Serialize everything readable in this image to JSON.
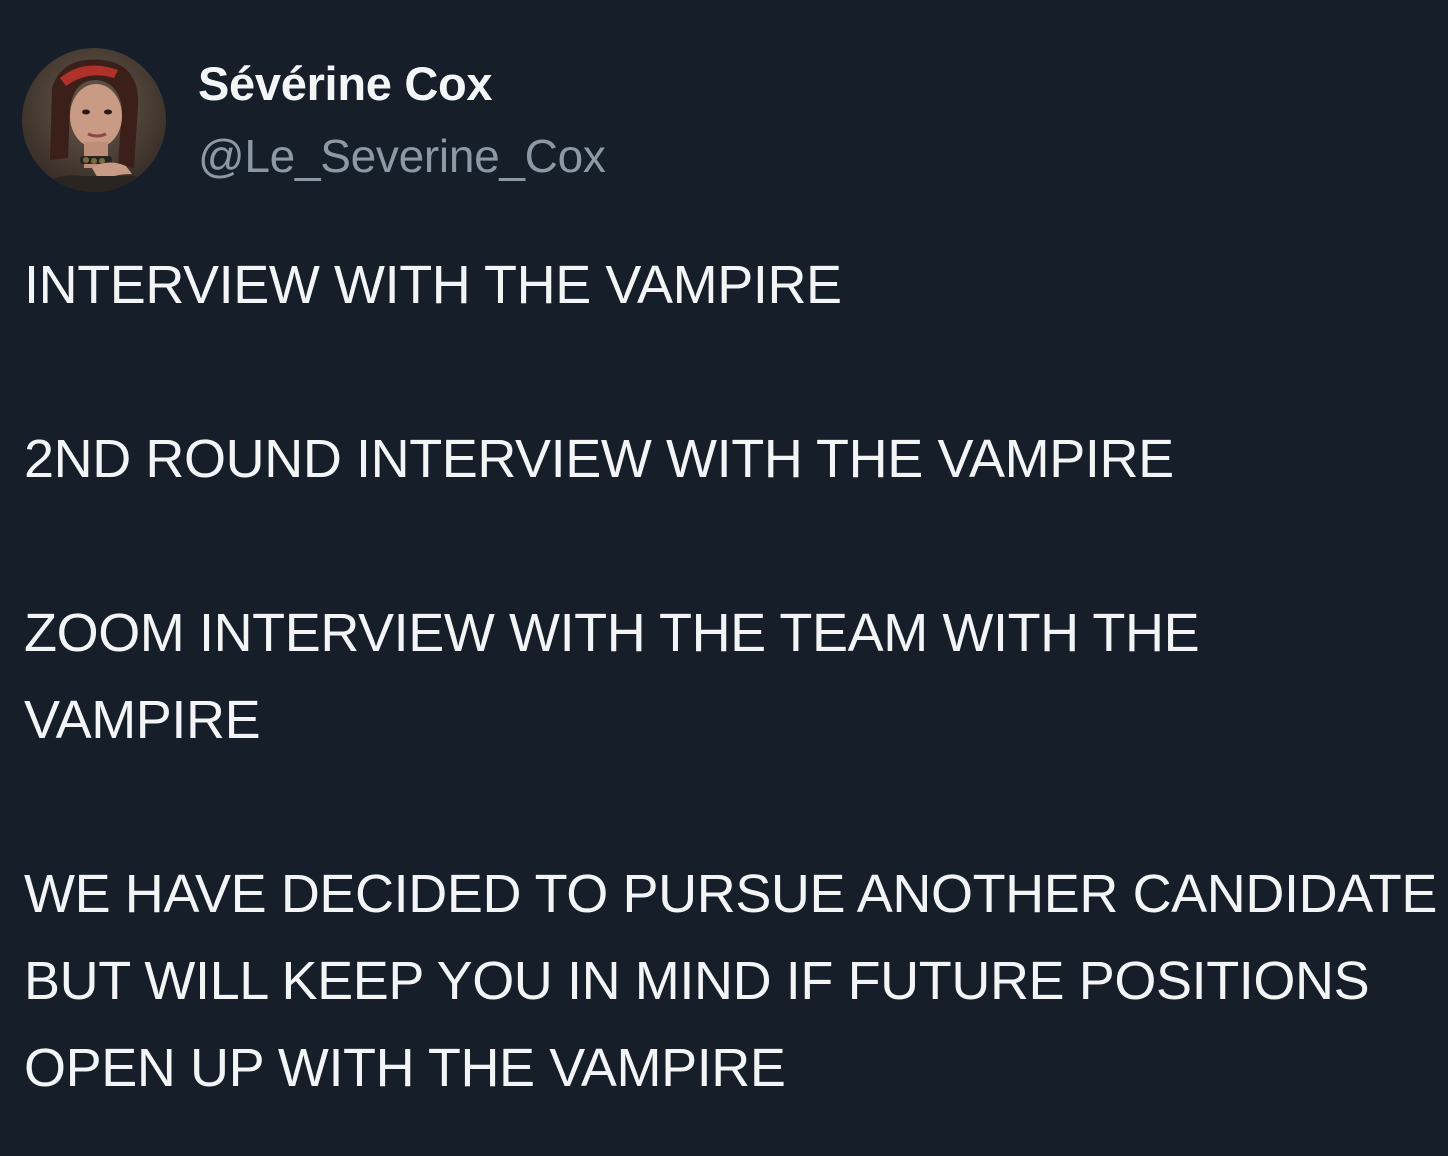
{
  "author": {
    "display_name": "Sévérine Cox",
    "handle": "@Le_Severine_Cox",
    "avatar_icon": "profile-photo"
  },
  "tweet": {
    "paragraphs": [
      "INTERVIEW WITH THE VAMPIRE",
      "2ND ROUND INTERVIEW WITH THE VAMPIRE",
      "ZOOM INTERVIEW WITH THE TEAM WITH THE VAMPIRE",
      "WE HAVE DECIDED TO PURSUE ANOTHER CANDIDATE BUT WILL KEEP YOU IN MIND IF FUTURE POSITIONS OPEN UP WITH THE VAMPIRE"
    ]
  },
  "colors": {
    "background": "#161e29",
    "text_primary": "#f3f4f5",
    "text_secondary": "#8b98a5"
  }
}
